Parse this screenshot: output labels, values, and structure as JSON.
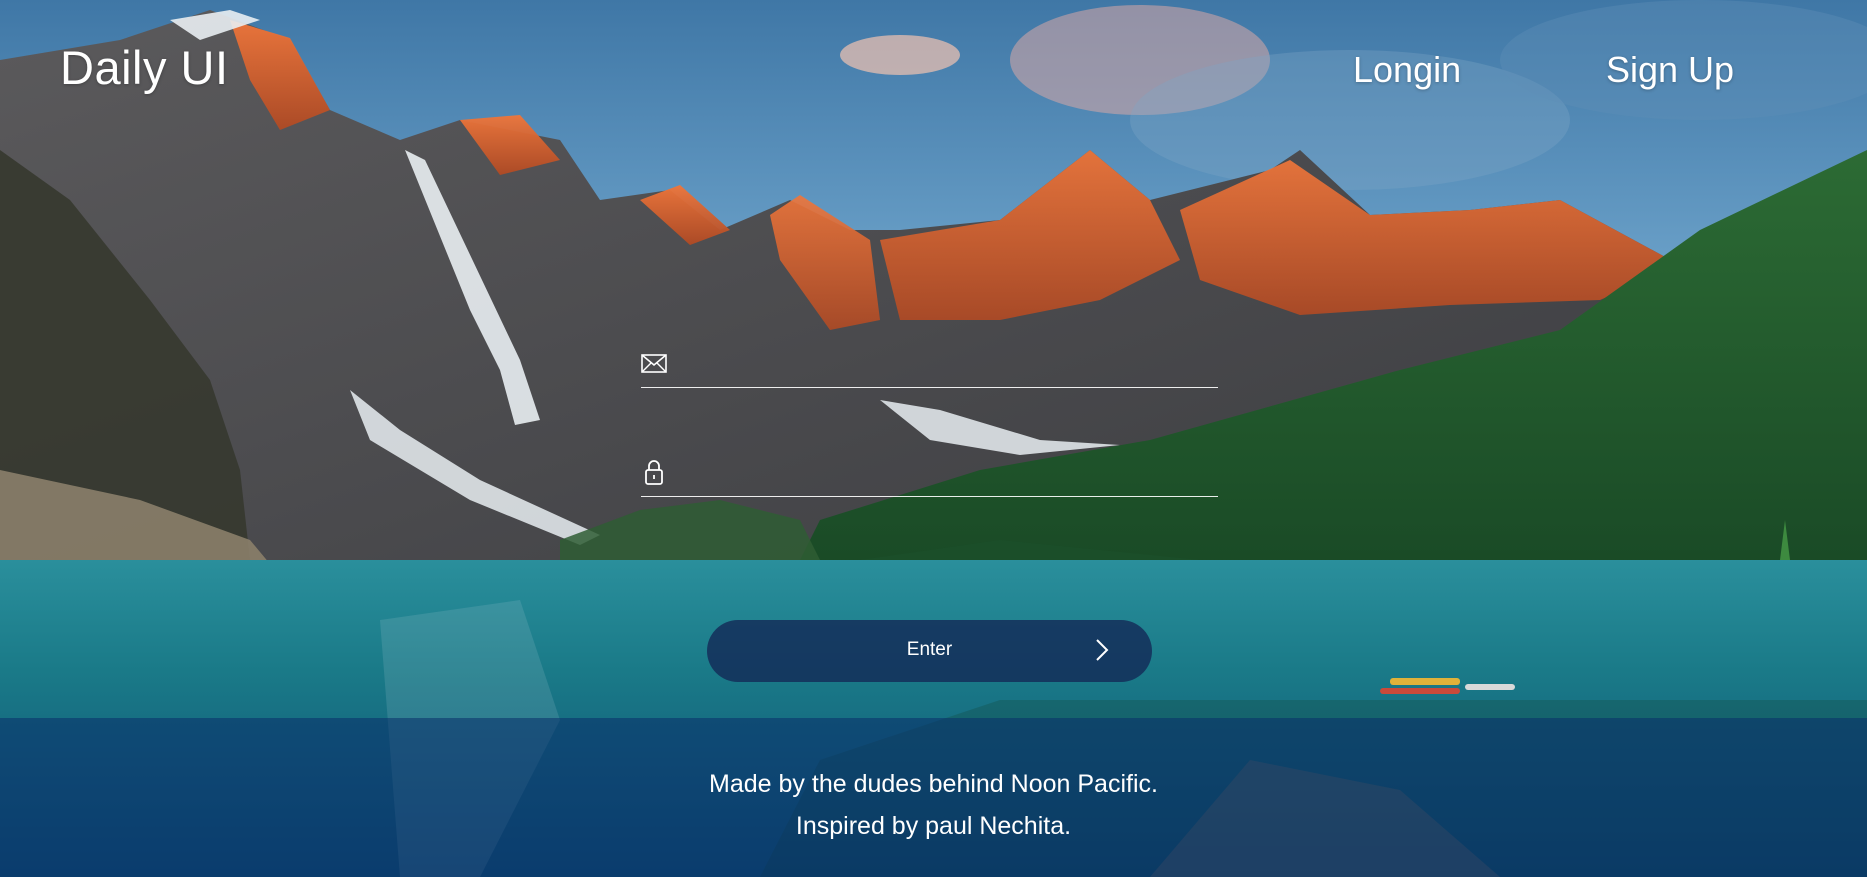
{
  "header": {
    "brand": "Daily UI",
    "nav": {
      "login_label": "Longin",
      "signup_label": "Sign Up"
    }
  },
  "form": {
    "email_icon": "envelope-icon",
    "password_icon": "lock-icon",
    "email_value": "",
    "password_value": "",
    "submit_label": "Enter",
    "submit_icon": "chevron-right-icon"
  },
  "footer": {
    "line1": "Made by the dudes behind Noon Pacific.",
    "line2": "Inspired by paul Nechita."
  },
  "colors": {
    "sky": "#4f86b3",
    "peaks": "#e0662d",
    "forest": "#1f5a2c",
    "lake": "#1f8a95",
    "button": "#132b58",
    "footer_band": "#0a2d69",
    "text": "#ffffff"
  }
}
